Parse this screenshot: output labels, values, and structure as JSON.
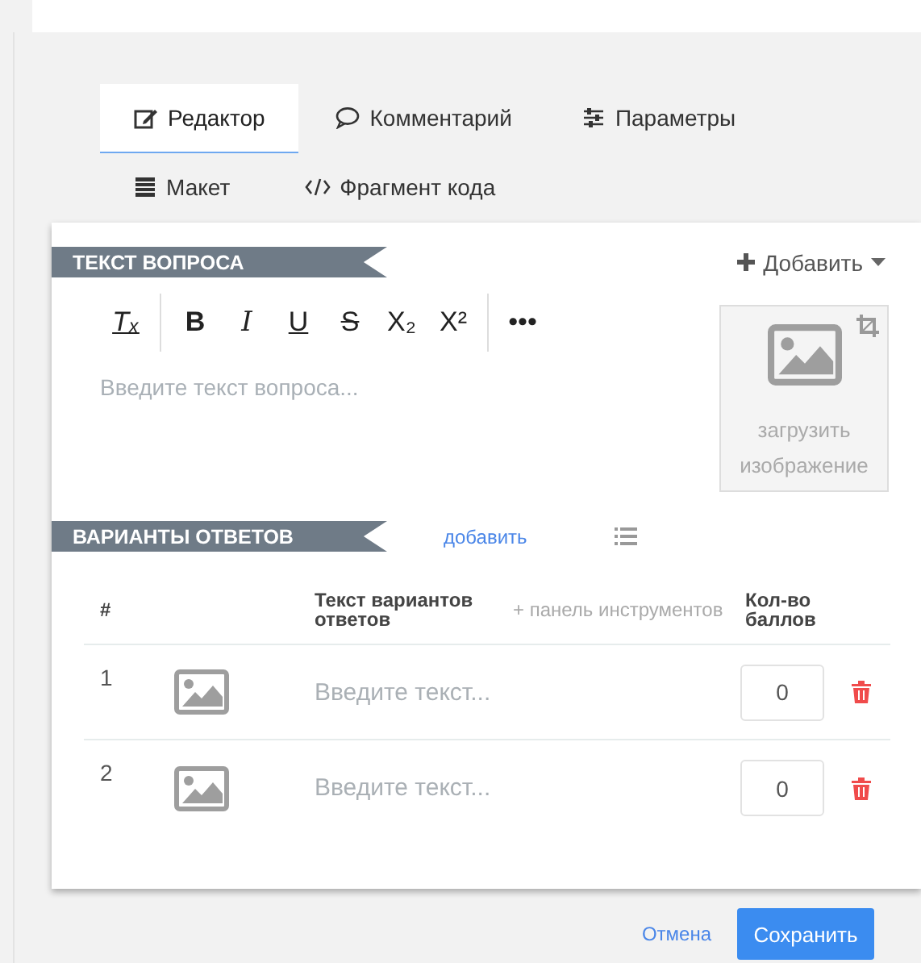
{
  "tabs": [
    {
      "label": "Редактор",
      "kind": "edit",
      "selected": true
    },
    {
      "label": "Комментарий",
      "kind": "comment",
      "selected": false
    },
    {
      "label": "Параметры",
      "kind": "sliders",
      "selected": false
    },
    {
      "label": "Макет",
      "kind": "layout",
      "selected": false
    },
    {
      "label": "Фрагмент кода",
      "kind": "code",
      "selected": false
    }
  ],
  "question": {
    "heading": "ТЕКСТ ВОПРОСА",
    "add_menu": "Добавить",
    "toolbar": [
      {
        "label": "Tₓ",
        "kind": "clear"
      },
      {
        "kind": "separator"
      },
      {
        "label": "B",
        "kind": "bold"
      },
      {
        "label": "I",
        "kind": "italic"
      },
      {
        "label": "U",
        "kind": "underline"
      },
      {
        "label": "S",
        "kind": "strike"
      },
      {
        "label": "X₂",
        "kind": "plain"
      },
      {
        "label": "X²",
        "kind": "plain"
      },
      {
        "kind": "separator"
      },
      {
        "label": "•••",
        "kind": "plain"
      }
    ],
    "placeholder": "Введите текст вопроса...",
    "upload": "загрузить изображение"
  },
  "answers": {
    "heading": "ВАРИАНТЫ ОТВЕТОВ",
    "add_link": "добавить",
    "columns": [
      "#",
      "Текст вариантов ответов",
      "+ панель инструментов",
      "Кол-во баллов"
    ],
    "rows": [
      {
        "number": "1",
        "placeholder": "Введите текст...",
        "points": "0"
      },
      {
        "number": "2",
        "placeholder": "Введите текст...",
        "points": "0"
      }
    ]
  },
  "buttons": {
    "cancel": "Отмена",
    "save": "Сохранить"
  }
}
